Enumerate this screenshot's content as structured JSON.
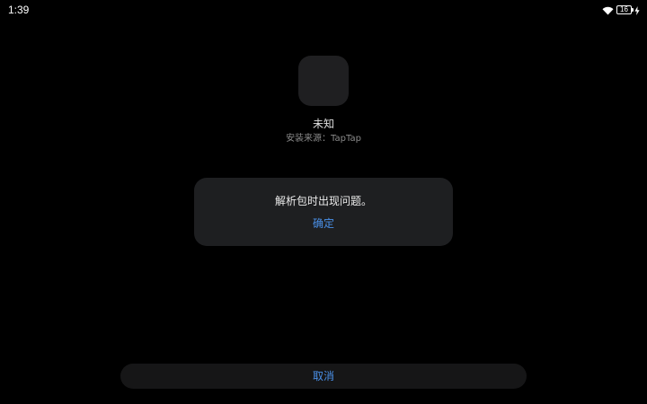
{
  "status_bar": {
    "time": "1:39",
    "battery_level": "16",
    "icons": [
      "wifi-icon",
      "battery-icon",
      "charging-icon"
    ]
  },
  "app": {
    "name": "未知",
    "install_source": "安装来源：TapTap",
    "icon_color": "#1f1f21"
  },
  "dialog": {
    "message": "解析包时出现问题。",
    "confirm_label": "确定"
  },
  "footer": {
    "cancel_label": "取消"
  },
  "colors": {
    "background": "#000000",
    "dialog_background": "#1e1f21",
    "accent": "#4a90e8"
  }
}
